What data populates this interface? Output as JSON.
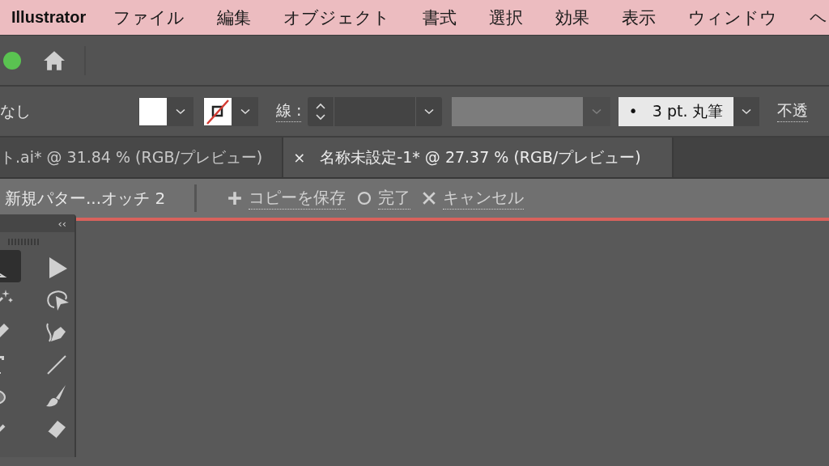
{
  "menu_bar": {
    "app_name": "Illustrator",
    "items": [
      "ファイル",
      "編集",
      "オブジェクト",
      "書式",
      "選択",
      "効果",
      "表示",
      "ウィンドウ",
      "ヘ"
    ]
  },
  "control_bar": {
    "fill_label": "なし",
    "stroke_label": "線 :",
    "brush": "•   3 pt. 丸筆",
    "opacity_label": "不透"
  },
  "tabs": [
    {
      "label": "ト.ai* @ 31.84 % (RGB/プレビュー)",
      "selected": false
    },
    {
      "label": "名称未設定-1* @ 27.37 % (RGB/プレビュー)",
      "selected": true,
      "close": "×"
    }
  ],
  "isolation_bar": {
    "breadcrumb": "新規パター...オッチ 2",
    "actions": [
      {
        "kind": "plus",
        "label": "コピーを保存"
      },
      {
        "kind": "circle",
        "label": "完了"
      },
      {
        "kind": "cross",
        "label": "キャンセル"
      }
    ]
  },
  "toolbox": {
    "collapse": "‹‹",
    "tools": [
      {
        "kind": "triangle",
        "selected": true
      },
      {
        "kind": "arrow",
        "selected": false
      },
      {
        "kind": "wand",
        "selected": false
      },
      {
        "kind": "lasso",
        "selected": false
      },
      {
        "kind": "pencil",
        "selected": false
      },
      {
        "kind": "pen",
        "selected": false
      },
      {
        "kind": "type",
        "selected": false
      },
      {
        "kind": "line",
        "selected": false
      },
      {
        "kind": "ellipse",
        "selected": false
      },
      {
        "kind": "brush",
        "selected": false
      },
      {
        "kind": "knife",
        "selected": false
      },
      {
        "kind": "eraser",
        "selected": false
      }
    ]
  }
}
